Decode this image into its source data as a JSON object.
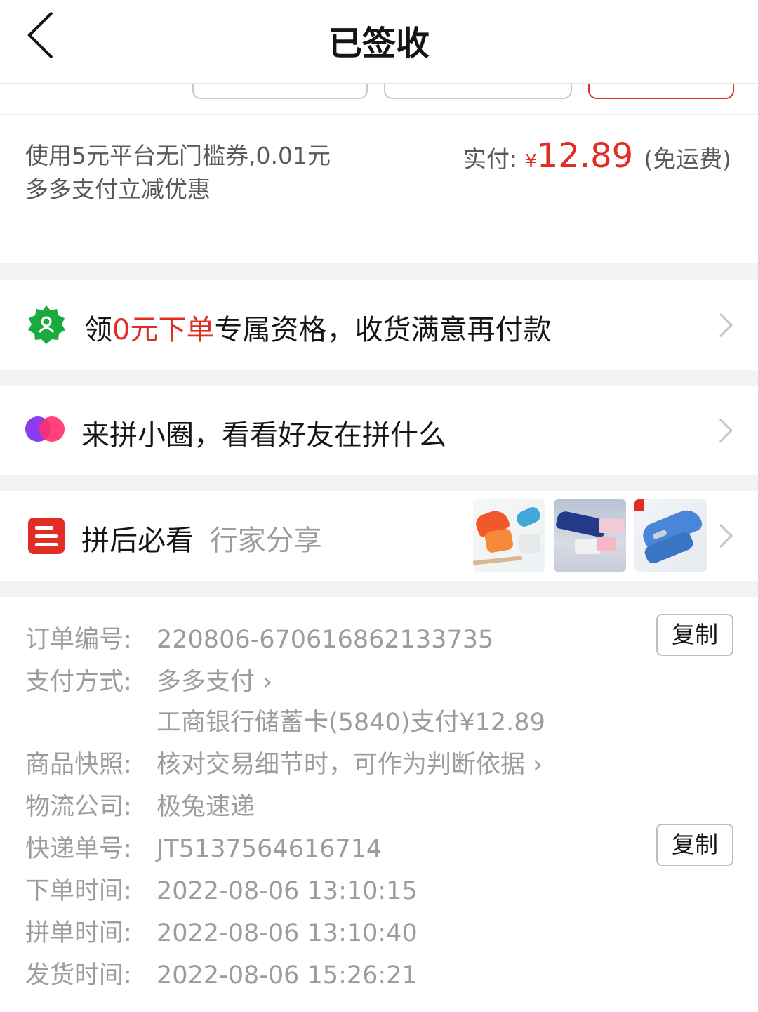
{
  "header": {
    "title": "已签收",
    "back_icon": "chevron-left-icon"
  },
  "payment": {
    "coupon_text": "使用5元平台无门槛券,0.01元多多支付立减优惠",
    "paid_label": "实付:",
    "currency": "¥",
    "amount": "12.89",
    "shipping_note": "(免运费)"
  },
  "promo": {
    "icon": "badge-user-icon",
    "prefix": "领",
    "highlight": "0元下单",
    "suffix": "专属资格，收货满意再付款"
  },
  "circle": {
    "icon": "overlapping-circles-icon",
    "text": "来拼小圈，看看好友在拼什么"
  },
  "must_see": {
    "icon": "list-icon",
    "title": "拼后必看",
    "subtitle": "行家分享",
    "thumbnails": [
      "stapler-product-thumb-1",
      "stapler-product-thumb-2",
      "stapler-product-thumb-3"
    ]
  },
  "details": {
    "order_no_label": "订单编号:",
    "order_no": "220806-670616862133735",
    "copy_label": "复制",
    "pay_method_label": "支付方式:",
    "pay_method": "多多支付 ›",
    "pay_detail": "工商银行储蓄卡(5840)支付¥12.89",
    "snapshot_label": "商品快照:",
    "snapshot": "核对交易细节时，可作为判断依据 ›",
    "carrier_label": "物流公司:",
    "carrier": "极兔速递",
    "tracking_label": "快递单号:",
    "tracking": "JT5137564616714",
    "order_time_label": "下单时间:",
    "order_time": "2022-08-06 13:10:15",
    "group_time_label": "拼单时间:",
    "group_time": "2022-08-06 13:10:40",
    "ship_time_label": "发货时间:",
    "ship_time": "2022-08-06 15:26:21"
  },
  "colors": {
    "accent": "#e02e24",
    "promo_green": "#1aab3f",
    "circle_purple": "#8a3cf0",
    "circle_pink": "#ff2d6e"
  }
}
